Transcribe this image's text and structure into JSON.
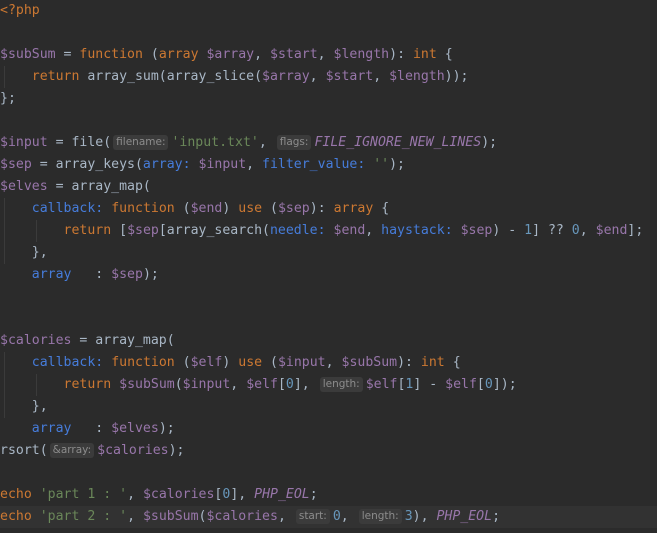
{
  "editor": {
    "language": "php",
    "lines": [
      [
        {
          "c": "tag",
          "t": "<?php"
        }
      ],
      [],
      [
        {
          "c": "var",
          "t": "$subSum"
        },
        {
          "c": "op",
          "t": " = "
        },
        {
          "c": "kw",
          "t": "function"
        },
        {
          "c": "op",
          "t": " ("
        },
        {
          "c": "kw",
          "t": "array"
        },
        {
          "c": "op",
          "t": " "
        },
        {
          "c": "var",
          "t": "$array"
        },
        {
          "c": "op",
          "t": ", "
        },
        {
          "c": "var",
          "t": "$start"
        },
        {
          "c": "op",
          "t": ", "
        },
        {
          "c": "var",
          "t": "$length"
        },
        {
          "c": "op",
          "t": "): "
        },
        {
          "c": "kw",
          "t": "int"
        },
        {
          "c": "op",
          "t": " {"
        }
      ],
      [
        {
          "c": "op",
          "t": "    "
        },
        {
          "c": "kw",
          "t": "return"
        },
        {
          "c": "fn",
          "t": " array_sum(array_slice("
        },
        {
          "c": "var",
          "t": "$array"
        },
        {
          "c": "op",
          "t": ", "
        },
        {
          "c": "var",
          "t": "$start"
        },
        {
          "c": "op",
          "t": ", "
        },
        {
          "c": "var",
          "t": "$length"
        },
        {
          "c": "op",
          "t": "));"
        }
      ],
      [
        {
          "c": "op",
          "t": "};"
        }
      ],
      [],
      [
        {
          "c": "var",
          "t": "$input"
        },
        {
          "c": "op",
          "t": " = file("
        },
        {
          "c": "hint",
          "t": "filename:"
        },
        {
          "c": "str",
          "t": "'input.txt'"
        },
        {
          "c": "op",
          "t": ", "
        },
        {
          "c": "hint",
          "t": "flags:"
        },
        {
          "c": "const",
          "t": "FILE_IGNORE_NEW_LINES"
        },
        {
          "c": "op",
          "t": ");"
        }
      ],
      [
        {
          "c": "var",
          "t": "$sep"
        },
        {
          "c": "op",
          "t": " = array_keys("
        },
        {
          "c": "named",
          "t": "array:"
        },
        {
          "c": "op",
          "t": " "
        },
        {
          "c": "var",
          "t": "$input"
        },
        {
          "c": "op",
          "t": ", "
        },
        {
          "c": "named",
          "t": "filter_value:"
        },
        {
          "c": "op",
          "t": " "
        },
        {
          "c": "str",
          "t": "''"
        },
        {
          "c": "op",
          "t": ");"
        }
      ],
      [
        {
          "c": "var",
          "t": "$elves"
        },
        {
          "c": "op",
          "t": " = array_map("
        }
      ],
      [
        {
          "c": "op",
          "t": "    "
        },
        {
          "c": "named",
          "t": "callback:"
        },
        {
          "c": "op",
          "t": " "
        },
        {
          "c": "kw",
          "t": "function"
        },
        {
          "c": "op",
          "t": " ("
        },
        {
          "c": "var",
          "t": "$end"
        },
        {
          "c": "op",
          "t": ") "
        },
        {
          "c": "kw",
          "t": "use"
        },
        {
          "c": "op",
          "t": " ("
        },
        {
          "c": "var",
          "t": "$sep"
        },
        {
          "c": "op",
          "t": "): "
        },
        {
          "c": "kw",
          "t": "array"
        },
        {
          "c": "op",
          "t": " {"
        }
      ],
      [
        {
          "c": "op",
          "t": "        "
        },
        {
          "c": "kw",
          "t": "return"
        },
        {
          "c": "op",
          "t": " ["
        },
        {
          "c": "var",
          "t": "$sep"
        },
        {
          "c": "op",
          "t": "[array_search("
        },
        {
          "c": "named",
          "t": "needle:"
        },
        {
          "c": "op",
          "t": " "
        },
        {
          "c": "var",
          "t": "$end"
        },
        {
          "c": "op",
          "t": ", "
        },
        {
          "c": "named",
          "t": "haystack:"
        },
        {
          "c": "op",
          "t": " "
        },
        {
          "c": "var",
          "t": "$sep"
        },
        {
          "c": "op",
          "t": ") - "
        },
        {
          "c": "num",
          "t": "1"
        },
        {
          "c": "op",
          "t": "] ?? "
        },
        {
          "c": "num",
          "t": "0"
        },
        {
          "c": "op",
          "t": ", "
        },
        {
          "c": "var",
          "t": "$end"
        },
        {
          "c": "op",
          "t": "];"
        }
      ],
      [
        {
          "c": "op",
          "t": "    },"
        }
      ],
      [
        {
          "c": "op",
          "t": "    "
        },
        {
          "c": "named",
          "t": "array"
        },
        {
          "c": "op",
          "t": "   : "
        },
        {
          "c": "var",
          "t": "$sep"
        },
        {
          "c": "op",
          "t": ");"
        }
      ],
      [],
      [],
      [
        {
          "c": "var",
          "t": "$calories"
        },
        {
          "c": "op",
          "t": " = array_map("
        }
      ],
      [
        {
          "c": "op",
          "t": "    "
        },
        {
          "c": "named",
          "t": "callback:"
        },
        {
          "c": "op",
          "t": " "
        },
        {
          "c": "kw",
          "t": "function"
        },
        {
          "c": "op",
          "t": " ("
        },
        {
          "c": "var",
          "t": "$elf"
        },
        {
          "c": "op",
          "t": ") "
        },
        {
          "c": "kw",
          "t": "use"
        },
        {
          "c": "op",
          "t": " ("
        },
        {
          "c": "var",
          "t": "$input"
        },
        {
          "c": "op",
          "t": ", "
        },
        {
          "c": "var",
          "t": "$subSum"
        },
        {
          "c": "op",
          "t": "): "
        },
        {
          "c": "kw",
          "t": "int"
        },
        {
          "c": "op",
          "t": " {"
        }
      ],
      [
        {
          "c": "op",
          "t": "        "
        },
        {
          "c": "kw",
          "t": "return"
        },
        {
          "c": "op",
          "t": " "
        },
        {
          "c": "var",
          "t": "$subSum"
        },
        {
          "c": "op",
          "t": "("
        },
        {
          "c": "var",
          "t": "$input"
        },
        {
          "c": "op",
          "t": ", "
        },
        {
          "c": "var",
          "t": "$elf"
        },
        {
          "c": "op",
          "t": "["
        },
        {
          "c": "num",
          "t": "0"
        },
        {
          "c": "op",
          "t": "], "
        },
        {
          "c": "hint",
          "t": "length:"
        },
        {
          "c": "var",
          "t": "$elf"
        },
        {
          "c": "op",
          "t": "["
        },
        {
          "c": "num",
          "t": "1"
        },
        {
          "c": "op",
          "t": "] - "
        },
        {
          "c": "var",
          "t": "$elf"
        },
        {
          "c": "op",
          "t": "["
        },
        {
          "c": "num",
          "t": "0"
        },
        {
          "c": "op",
          "t": "]);"
        }
      ],
      [
        {
          "c": "op",
          "t": "    },"
        }
      ],
      [
        {
          "c": "op",
          "t": "    "
        },
        {
          "c": "named",
          "t": "array"
        },
        {
          "c": "op",
          "t": "   : "
        },
        {
          "c": "var",
          "t": "$elves"
        },
        {
          "c": "op",
          "t": ");"
        }
      ],
      [
        {
          "c": "op",
          "t": "rsort("
        },
        {
          "c": "hint",
          "t": "&array:"
        },
        {
          "c": "var",
          "t": "$calories"
        },
        {
          "c": "op",
          "t": ");"
        }
      ],
      [],
      [
        {
          "c": "kw",
          "t": "echo"
        },
        {
          "c": "op",
          "t": " "
        },
        {
          "c": "str",
          "t": "'part 1 : '"
        },
        {
          "c": "op",
          "t": ", "
        },
        {
          "c": "var",
          "t": "$calories"
        },
        {
          "c": "op",
          "t": "["
        },
        {
          "c": "num",
          "t": "0"
        },
        {
          "c": "op",
          "t": "], "
        },
        {
          "c": "const",
          "t": "PHP_EOL"
        },
        {
          "c": "op",
          "t": ";"
        }
      ],
      [
        {
          "c": "kw",
          "t": "echo"
        },
        {
          "c": "op",
          "t": " "
        },
        {
          "c": "str",
          "t": "'part 2 : '"
        },
        {
          "c": "op",
          "t": ", "
        },
        {
          "c": "var",
          "t": "$subSum"
        },
        {
          "c": "op",
          "t": "("
        },
        {
          "c": "var",
          "t": "$calories"
        },
        {
          "c": "op",
          "t": ", "
        },
        {
          "c": "hint",
          "t": "start:"
        },
        {
          "c": "num",
          "t": "0"
        },
        {
          "c": "op",
          "t": ", "
        },
        {
          "c": "hint",
          "t": "length:"
        },
        {
          "c": "num",
          "t": "3"
        },
        {
          "c": "op",
          "t": "), "
        },
        {
          "c": "const",
          "t": "PHP_EOL"
        },
        {
          "c": "op",
          "t": ";"
        }
      ]
    ],
    "current_line_index": 23,
    "colors": {
      "background": "#2b2b2b",
      "current_line": "#323232",
      "keyword": "#cc7832",
      "variable": "#9876aa",
      "string": "#6a8759",
      "number": "#6897bb",
      "named_argument": "#467cda",
      "text": "#a9b7c6",
      "hint_background": "#3b3b3b",
      "hint_text": "#8c8c8c"
    }
  }
}
